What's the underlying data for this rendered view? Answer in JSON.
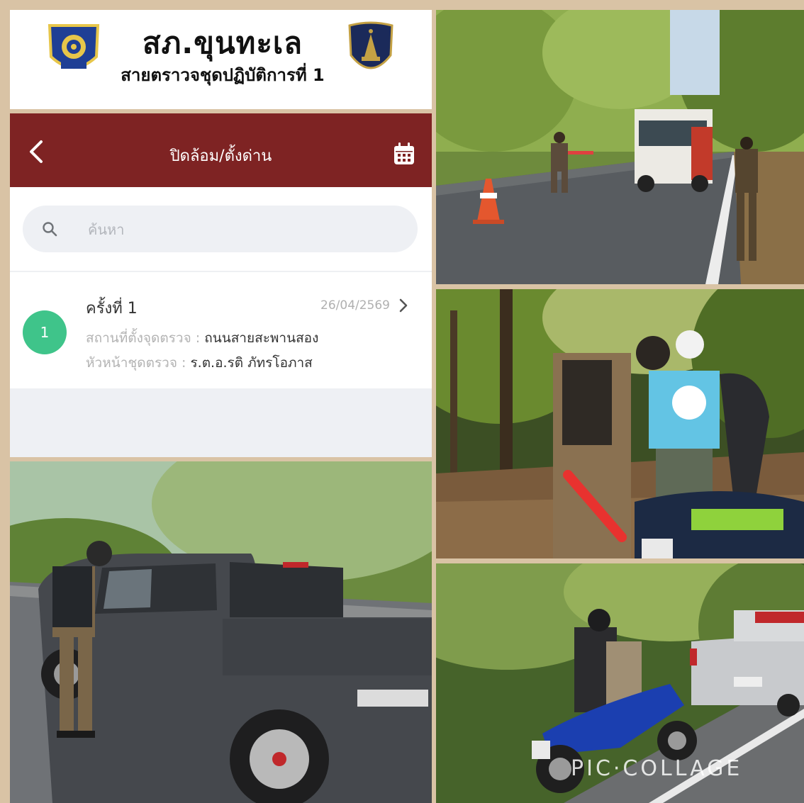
{
  "header": {
    "station_name": "สภ.ขุนทะเล",
    "unit_name": "สายตราวจชุดปฏิบัติการที่ 1",
    "left_emblem_icon": "police-badge-icon",
    "right_emblem_icon": "police-shield-icon"
  },
  "app": {
    "title": "ปิดล้อม/ตั้งด่าน",
    "back_icon": "chevron-left-icon",
    "calendar_icon": "calendar-icon",
    "search": {
      "placeholder": "ค้นหา",
      "value": "",
      "icon": "search-icon"
    },
    "items": [
      {
        "number": "1",
        "title": "ครั้งที่ 1",
        "date": "26/04/2569",
        "location_label": "สถานที่ตั้งจุดตรวจ :",
        "location_value": "ถนนสายสะพานสอง",
        "head_label": "หัวหน้าชุดตรวจ :",
        "head_value": "ร.ต.อ.รติ ภัทรโอภาส"
      }
    ]
  },
  "photos": {
    "watermark": "PIC·COLLAGE"
  },
  "colors": {
    "appbar": "#7e2323",
    "badge": "#3fc48a",
    "collage_border": "#d9c3a5",
    "search_bg": "#eef0f4"
  }
}
